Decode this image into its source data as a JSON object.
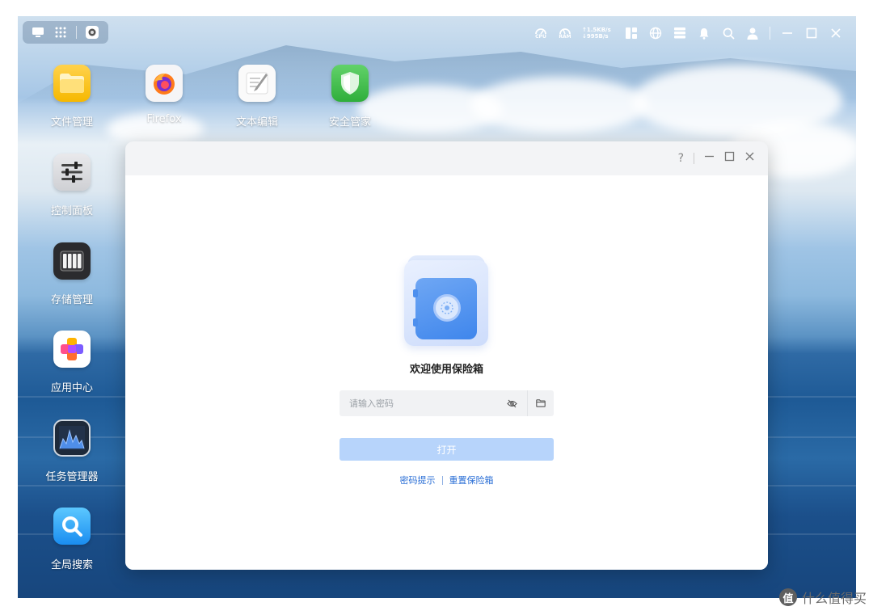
{
  "topbar": {
    "left_icons": [
      "desktop-icon",
      "app-grid-icon",
      "current-app-icon"
    ],
    "cpu_label": "CPU",
    "ram_label": "RAM",
    "net_up": "1.5KB/s",
    "net_down": "995B/s",
    "tray_icons": [
      "widget-panel-icon",
      "globe-icon",
      "server-status-icon",
      "bell-icon",
      "search-icon",
      "user-icon"
    ],
    "window_controls": [
      "minimize-icon",
      "maximize-icon",
      "close-icon"
    ]
  },
  "desktop": {
    "apps": [
      {
        "label": "文件管理",
        "icon": "folder-icon"
      },
      {
        "label": "Firefox",
        "icon": "firefox-icon"
      },
      {
        "label": "文本编辑",
        "icon": "text-editor-icon"
      },
      {
        "label": "安全管家",
        "icon": "shield-icon"
      },
      {
        "label": "控制面板",
        "icon": "sliders-icon"
      },
      {
        "label": "存储管理",
        "icon": "storage-icon"
      },
      {
        "label": "应用中心",
        "icon": "app-center-icon"
      },
      {
        "label": "任务管理器",
        "icon": "task-manager-icon"
      },
      {
        "label": "全局搜索",
        "icon": "global-search-icon"
      }
    ]
  },
  "vault": {
    "help": "?",
    "title": "欢迎使用保险箱",
    "password_placeholder": "请输入密码",
    "password_value": "",
    "open_button": "打开",
    "link_hint": "密码提示",
    "link_reset": "重置保险箱",
    "colors": {
      "accent": "#2b6fd6",
      "button_disabled": "#b7d4fb",
      "safe_blue": "#3f86ec"
    }
  },
  "watermark": {
    "badge": "值",
    "text": "什么值得买"
  }
}
